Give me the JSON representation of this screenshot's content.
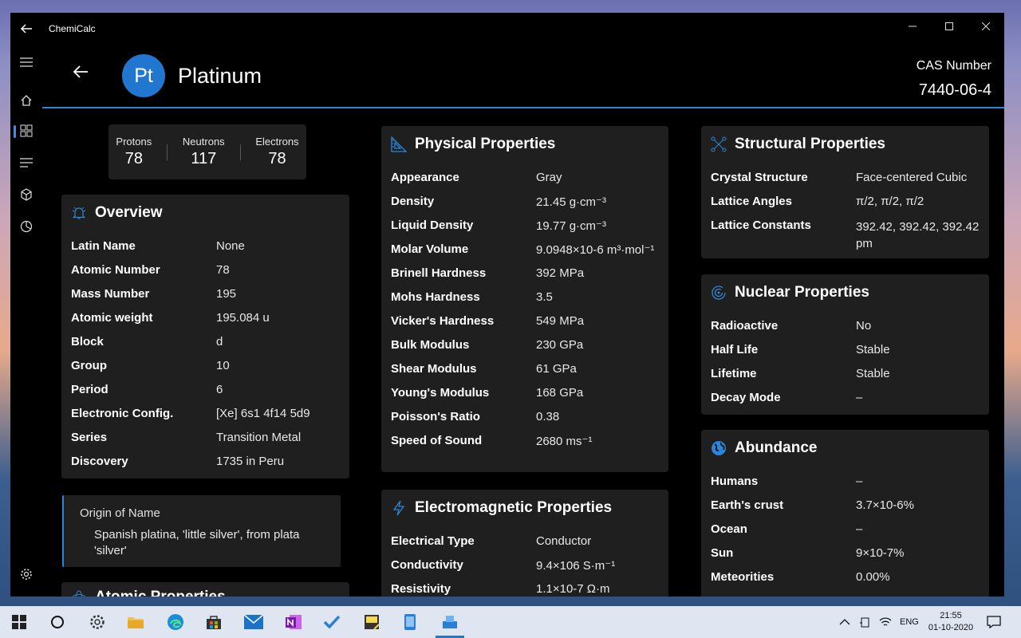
{
  "app": {
    "title": "ChemiCalc"
  },
  "element": {
    "symbol": "Pt",
    "name": "Platinum",
    "cas_label": "CAS Number",
    "cas_number": "7440-06-4"
  },
  "particles": [
    {
      "label": "Protons",
      "value": "78"
    },
    {
      "label": "Neutrons",
      "value": "117"
    },
    {
      "label": "Electrons",
      "value": "78"
    }
  ],
  "overview": {
    "title": "Overview",
    "rows": [
      {
        "k": "Latin Name",
        "v": "None"
      },
      {
        "k": "Atomic Number",
        "v": "78"
      },
      {
        "k": "Mass Number",
        "v": "195"
      },
      {
        "k": "Atomic weight",
        "v": "195.084 u"
      },
      {
        "k": "Block",
        "v": "d"
      },
      {
        "k": "Group",
        "v": "10"
      },
      {
        "k": "Period",
        "v": "6"
      },
      {
        "k": "Electronic Config.",
        "v": "[Xe] 6s1 4f14 5d9"
      },
      {
        "k": "Series",
        "v": "Transition Metal"
      },
      {
        "k": "Discovery",
        "v": "1735 in Peru"
      }
    ]
  },
  "origin": {
    "label": "Origin of Name",
    "text": "Spanish platina, 'little silver', from plata 'silver'"
  },
  "next_card_title": "Atomic Properties",
  "physical": {
    "title": "Physical Properties",
    "rows": [
      {
        "k": "Appearance",
        "v": "Gray"
      },
      {
        "k": "Density",
        "v": "21.45 g·cm⁻³"
      },
      {
        "k": "Liquid Density",
        "v": "19.77 g·cm⁻³"
      },
      {
        "k": "Molar Volume",
        "v": "9.0948×10-6 m³·mol⁻¹"
      },
      {
        "k": "Brinell Hardness",
        "v": "392 MPa"
      },
      {
        "k": "Mohs Hardness",
        "v": "3.5"
      },
      {
        "k": "Vicker's Hardness",
        "v": "549 MPa"
      },
      {
        "k": "Bulk Modulus",
        "v": "230 GPa"
      },
      {
        "k": "Shear Modulus",
        "v": "61 GPa"
      },
      {
        "k": "Young's Modulus",
        "v": "168 GPa"
      },
      {
        "k": "Poisson's Ratio",
        "v": "0.38"
      },
      {
        "k": "Speed of Sound",
        "v": "2680 ms⁻¹"
      }
    ]
  },
  "electromagnetic": {
    "title": "Electromagnetic Properties",
    "rows": [
      {
        "k": "Electrical Type",
        "v": "Conductor"
      },
      {
        "k": "Conductivity",
        "v": "9.4×106 S·m⁻¹"
      },
      {
        "k": "Resistivity",
        "v": "1.1×10-7 Ω·m"
      }
    ]
  },
  "structural": {
    "title": "Structural Properties",
    "rows": [
      {
        "k": "Crystal Structure",
        "v": "Face-centered Cubic"
      },
      {
        "k": "Lattice Angles",
        "v": "π/2, π/2, π/2"
      },
      {
        "k": "Lattice Constants",
        "v": "392.42, 392.42, 392.42 pm"
      }
    ]
  },
  "nuclear": {
    "title": "Nuclear Properties",
    "rows": [
      {
        "k": "Radioactive",
        "v": "No"
      },
      {
        "k": "Half Life",
        "v": "Stable"
      },
      {
        "k": "Lifetime",
        "v": "Stable"
      },
      {
        "k": "Decay Mode",
        "v": "–"
      }
    ]
  },
  "abundance": {
    "title": "Abundance",
    "rows": [
      {
        "k": "Humans",
        "v": "–"
      },
      {
        "k": "Earth's crust",
        "v": "3.7×10-6%"
      },
      {
        "k": "Ocean",
        "v": "–"
      },
      {
        "k": "Sun",
        "v": "9×10-7%"
      },
      {
        "k": "Meteorities",
        "v": "0.00%"
      }
    ]
  },
  "taskbar": {
    "lang": "ENG",
    "time": "21:55",
    "date": "01-10-2020"
  },
  "colors": {
    "accent": "#2c86d8",
    "card": "#1f1f1f",
    "bg": "#000000"
  }
}
